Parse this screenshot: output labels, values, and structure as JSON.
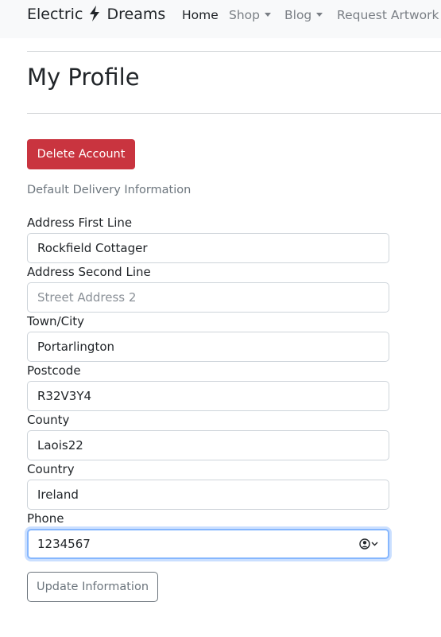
{
  "navbar": {
    "brand_left": "Electric",
    "brand_right": "Dreams",
    "items": [
      {
        "label": "Home",
        "active": true
      },
      {
        "label": "Shop",
        "dropdown": true
      },
      {
        "label": "Blog",
        "dropdown": true
      },
      {
        "label": "Request Artwork"
      }
    ]
  },
  "page": {
    "title": "My Profile",
    "delete_button": "Delete Account",
    "section_label": "Default Delivery Information",
    "update_button": "Update Information"
  },
  "form": {
    "fields": [
      {
        "label": "Address First Line",
        "value": "Rockfield Cottager",
        "placeholder": ""
      },
      {
        "label": "Address Second Line",
        "value": "",
        "placeholder": "Street Address 2"
      },
      {
        "label": "Town/City",
        "value": "Portarlington",
        "placeholder": ""
      },
      {
        "label": "Postcode",
        "value": "R32V3Y4",
        "placeholder": ""
      },
      {
        "label": "County",
        "value": "Laois22",
        "placeholder": ""
      },
      {
        "label": "Country",
        "value": "Ireland",
        "placeholder": ""
      },
      {
        "label": "Phone",
        "value": "1234567",
        "placeholder": "",
        "focused": true
      }
    ]
  },
  "colors": {
    "danger": "#c9343f",
    "secondary": "#6c757d",
    "navbar_bg": "#f8f9fa",
    "focus_ring": "#86b7fe"
  },
  "icons": [
    "lightning-bolt-icon",
    "caret-down-icon",
    "autofill-contact-icon",
    "chevron-down-icon"
  ]
}
